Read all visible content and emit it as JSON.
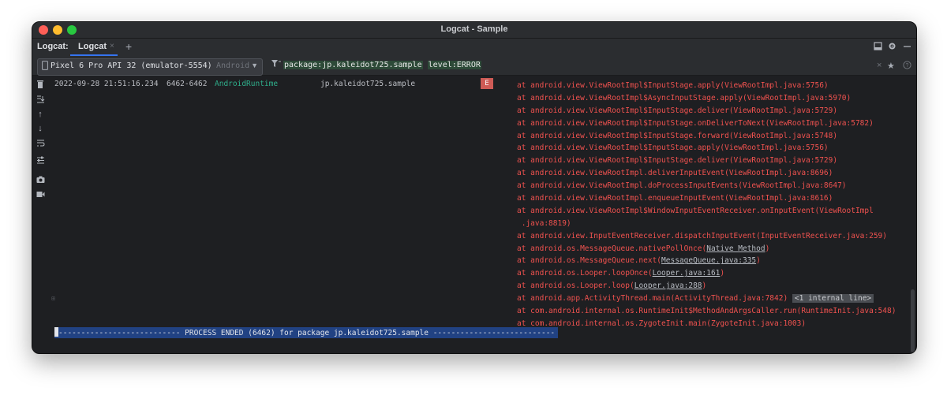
{
  "window": {
    "title": "Logcat - Sample"
  },
  "tabbar": {
    "tool_label": "Logcat:",
    "tab_label": "Logcat",
    "close_glyph": "×",
    "add_glyph": "+",
    "right_icons": [
      "layout-icon",
      "gear-icon",
      "minimize-icon"
    ]
  },
  "device": {
    "name": "Pixel 6 Pro API 32 (emulator-5554)",
    "status": "Android",
    "icon": "phone-icon"
  },
  "filter": {
    "package_key": "package:",
    "package_val": "jp.kaleidot725.sample",
    "level_key": "level:",
    "level_val": "ERROR",
    "icons": [
      "filter-icon",
      "clear-icon",
      "star-icon",
      "help-icon"
    ]
  },
  "left_tools": [
    "trash-icon",
    "scroll-to-end-icon",
    "up-arrow-icon",
    "down-arrow-icon",
    "soft-wrap-icon",
    "settings-icon",
    "camera-icon",
    "video-icon"
  ],
  "log": {
    "timestamp": "2022-09-28 21:51:16.234",
    "pid": "6462-6462",
    "tag": "AndroidRuntime",
    "package": "jp.kaleidot725.sample",
    "level": "E",
    "lines": [
      "at android.view.ViewRootImpl$InputStage.apply(ViewRootImpl.java:5756)",
      "at android.view.ViewRootImpl$AsyncInputStage.apply(ViewRootImpl.java:5970)",
      "at android.view.ViewRootImpl$InputStage.deliver(ViewRootImpl.java:5729)",
      "at android.view.ViewRootImpl$InputStage.onDeliverToNext(ViewRootImpl.java:5782)",
      "at android.view.ViewRootImpl$InputStage.forward(ViewRootImpl.java:5748)",
      "at android.view.ViewRootImpl$InputStage.apply(ViewRootImpl.java:5756)",
      "at android.view.ViewRootImpl$InputStage.deliver(ViewRootImpl.java:5729)",
      "at android.view.ViewRootImpl.deliverInputEvent(ViewRootImpl.java:8696)",
      "at android.view.ViewRootImpl.doProcessInputEvents(ViewRootImpl.java:8647)",
      "at android.view.ViewRootImpl.enqueueInputEvent(ViewRootImpl.java:8616)",
      "at android.view.ViewRootImpl$WindowInputEventReceiver.onInputEvent(ViewRootImpl",
      " .java:8819)",
      "at android.view.InputEventReceiver.dispatchInputEvent(InputEventReceiver.java:259)"
    ],
    "line_native": {
      "pre": "at android.os.MessageQueue.nativePollOnce(",
      "link": "Native Method",
      "post": ")"
    },
    "line_next": {
      "pre": "at android.os.MessageQueue.next(",
      "link": "MessageQueue.java:335",
      "post": ")"
    },
    "line_looponce": {
      "pre": "at android.os.Looper.loopOnce(",
      "link": "Looper.java:161",
      "post": ")"
    },
    "line_loop": {
      "pre": "at android.os.Looper.loop(",
      "link": "Looper.java:288",
      "post": ")"
    },
    "line_main": {
      "pre": "at android.app.ActivityThread.main(ActivityThread.java:7842)",
      "badge": "<1 internal line>"
    },
    "line_runtime": "at com.android.internal.os.RuntimeInit$MethodAndArgsCaller.run(RuntimeInit.java:548)",
    "line_zygote": "at com.android.internal.os.ZygoteInit.main(ZygoteInit.java:1003)",
    "process_ended": "--------------------------- PROCESS ENDED (6462) for package jp.kaleidot725.sample ---------------------------"
  },
  "colors": {
    "error_red": "#f0524f",
    "tag_green": "#2fae8b",
    "selection_blue": "#214283",
    "accent": "#3574f0"
  }
}
